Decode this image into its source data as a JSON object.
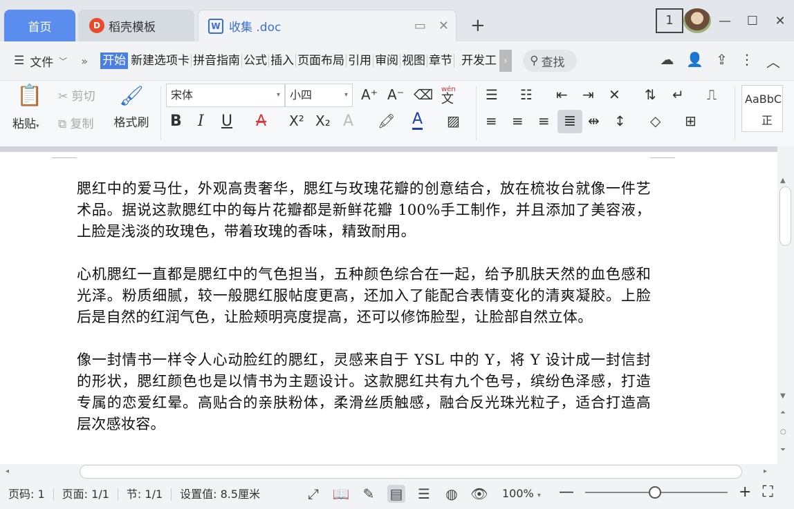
{
  "tabs": {
    "home": "首页",
    "daoke": "稻壳模板",
    "daoke_logo": "D",
    "doc": "收集 .doc",
    "doc_logo": "W"
  },
  "window": {
    "page_indicator": "1",
    "new_tab": "+"
  },
  "menu": {
    "file": "文件",
    "more": "»",
    "tabs": [
      "开始",
      "新建选项卡",
      "拼音指南",
      "公式",
      "插入",
      "页面布局",
      "引用",
      "审阅",
      "视图",
      "章节",
      "开发工"
    ],
    "search": "查找"
  },
  "ribbon": {
    "paste": "粘贴",
    "cut": "剪切",
    "copy": "复制",
    "format_painter": "格式刷",
    "font": "宋体",
    "font_size": "小四",
    "pinyin_label": "wén",
    "style_preview": "AaBbC",
    "style_name": "正文"
  },
  "document": {
    "paragraphs": [
      "腮红中的爱马仕，外观高贵奢华，腮红与玫瑰花瓣的创意结合，放在梳妆台就像一件艺术品。据说这款腮红中的每片花瓣都是新鲜花瓣 100%手工制作，并且添加了美容液，上脸是浅淡的玫瑰色，带着玫瑰的香味，精致耐用。",
      "心机腮红一直都是腮红中的气色担当，五种颜色综合在一起，给予肌肤天然的血色感和光泽。粉质细腻，较一般腮红服帖度更高，还加入了能配合表情变化的清爽凝胶。上脸后是自然的红润气色，让脸颊明亮度提高，还可以修饰脸型，让脸部自然立体。",
      "像一封情书一样令人心动脸红的腮红，灵感来自于 YSL 中的 Y，将 Y 设计成一封信封的形状，腮红颜色也是以情书为主题设计。这款腮红共有九个色号，缤纷色泽感，打造专属的恋爱红晕。高贴合的亲肤粉体，柔滑丝质触感，融合反光珠光粒子，适合打造高层次感妆容。"
    ]
  },
  "status": {
    "page": "页码: 1",
    "pages": "页面: 1/1",
    "section": "节: 1/1",
    "setting": "设置值: 8.5厘米",
    "zoom": "100%",
    "zoom_level_percent": 100
  },
  "colors": {
    "accent": "#4a7fe0",
    "home_tab": "#5b8def"
  }
}
